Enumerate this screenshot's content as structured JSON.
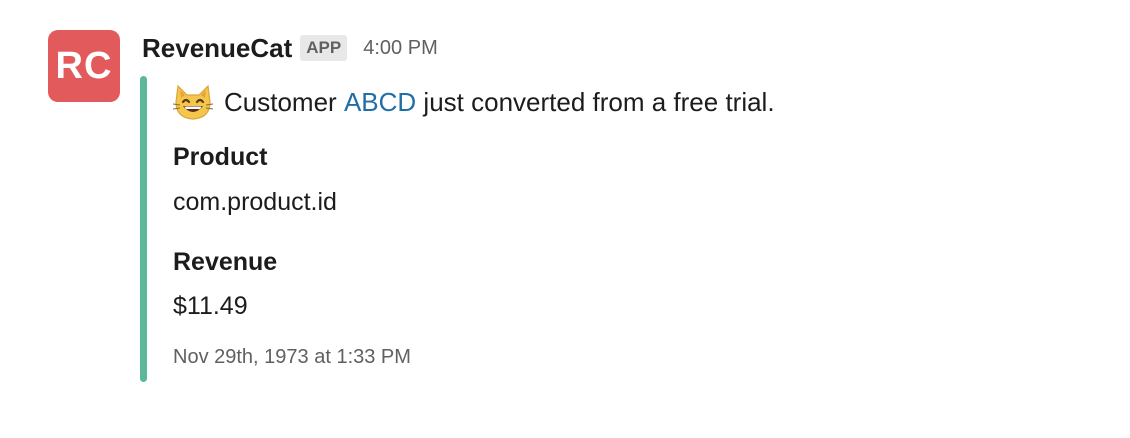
{
  "message": {
    "avatar_text": "RC",
    "sender": "RevenueCat",
    "badge": "APP",
    "time": "4:00 PM"
  },
  "attachment": {
    "bar_color": "#5bb89a",
    "icon": "grinning-cat-icon",
    "pretext_before": "Customer ",
    "customer_link": "ABCD",
    "pretext_after": " just converted from a free trial.",
    "fields": [
      {
        "title": "Product",
        "value": "com.product.id"
      },
      {
        "title": "Revenue",
        "value": "$11.49"
      }
    ],
    "footer_timestamp": "Nov 29th, 1973 at 1:33 PM"
  },
  "colors": {
    "avatar_bg": "#e35a5c",
    "link": "#1f6ea8",
    "muted_text": "#616061"
  }
}
